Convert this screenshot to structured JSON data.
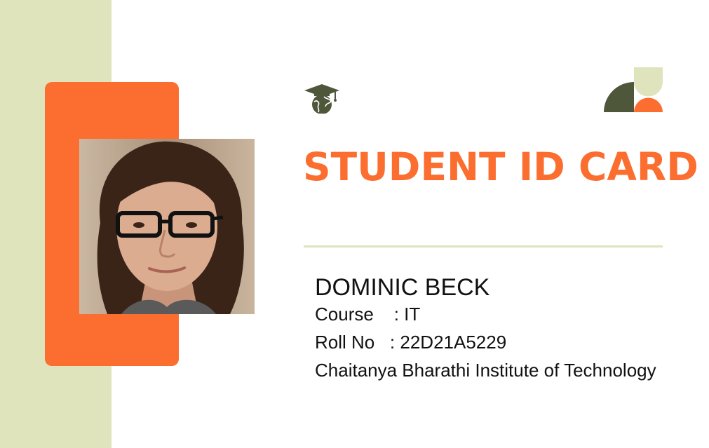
{
  "card": {
    "title": "STUDENT ID CARD",
    "name": "DOMINIC BECK",
    "course": "Course    : IT",
    "roll": "Roll No   : 22D21A5229",
    "institution": "Chaitanya Bharathi Institute of Technology"
  },
  "icons": {
    "logo": "graduation-cap-globe-icon",
    "decoration": "geometric-shapes-decoration"
  },
  "colors": {
    "accent": "#fb6e30",
    "sage": "#dfe4bd",
    "olive": "#4e573a"
  }
}
